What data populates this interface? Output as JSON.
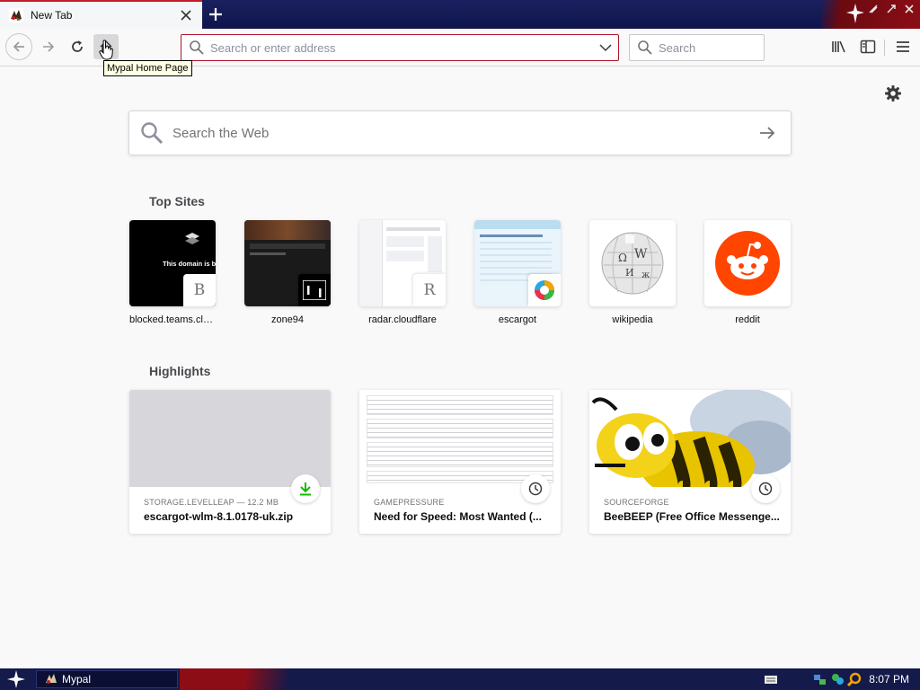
{
  "tab": {
    "title": "New Tab",
    "favicon": "mypal-logo-icon"
  },
  "toolbar": {
    "home_tooltip": "Mypal Home Page",
    "url_placeholder": "Search or enter address",
    "search_placeholder": "Search"
  },
  "newtab": {
    "web_search_placeholder": "Search the Web",
    "top_sites_title": "Top Sites",
    "highlights_title": "Highlights",
    "top_sites": [
      {
        "label": "blocked.teams.clo...",
        "badge": "B",
        "preview_text": "This domain is block"
      },
      {
        "label": "zone94",
        "badge": "",
        "preview_text": ""
      },
      {
        "label": "radar.cloudflare",
        "badge": "R",
        "preview_text": ""
      },
      {
        "label": "escargot",
        "badge": "",
        "preview_text": ""
      },
      {
        "label": "wikipedia",
        "badge": "",
        "preview_text": ""
      },
      {
        "label": "reddit",
        "badge": "",
        "preview_text": ""
      }
    ],
    "highlights": [
      {
        "context": "STORAGE.LEVELLEAP — 12.2 MB",
        "title": "escargot-wlm-8.1.0178-uk.zip",
        "icon": "download-icon"
      },
      {
        "context": "GAMEPRESSURE",
        "title": "Need for Speed: Most Wanted (...",
        "icon": "clock-icon"
      },
      {
        "context": "SOURCEFORGE",
        "title": "BeeBEEP (Free Office Messenge...",
        "icon": "clock-icon"
      }
    ]
  },
  "taskbar": {
    "app_label": "Mypal",
    "clock": "8:07 PM"
  },
  "colors": {
    "accent_red": "#b1152a",
    "taskbar_blue": "#141a4a",
    "download_green": "#12bc00",
    "reddit_orange": "#ff4500"
  }
}
